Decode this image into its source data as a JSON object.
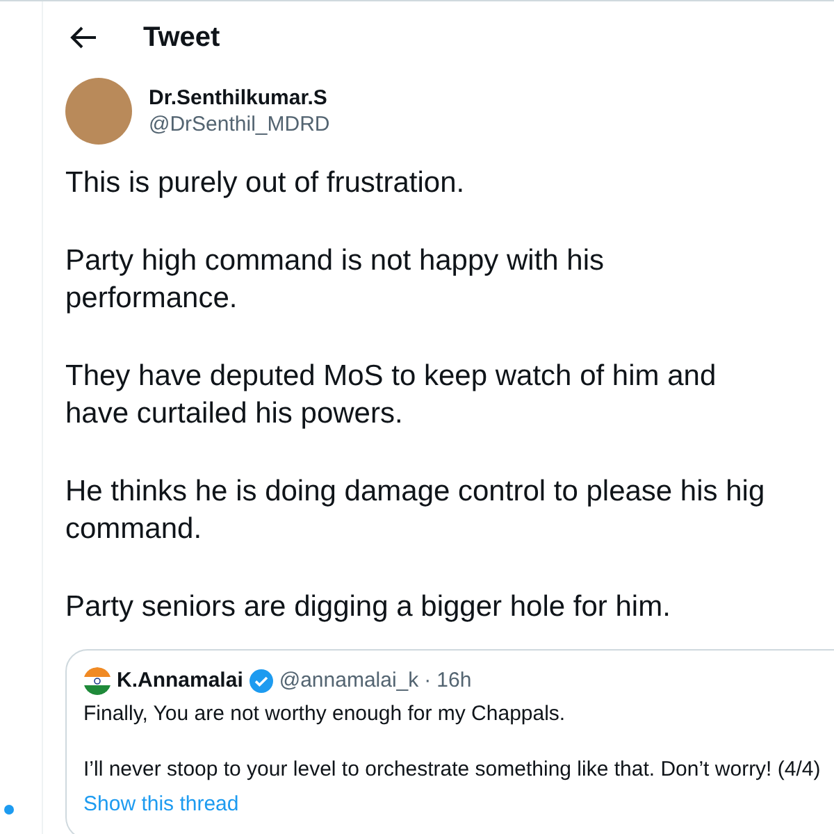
{
  "header": {
    "title": "Tweet"
  },
  "author": {
    "name": "Dr.Senthilkumar.S",
    "handle": "@DrSenthil_MDRD"
  },
  "paragraphs": [
    "This is purely out of frustration.",
    "Party high command is not happy with his\nperformance.",
    "They have deputed MoS to keep watch of him and\nhave curtailed his powers.",
    "He thinks he is doing damage control to please his hig\ncommand.",
    "Party seniors are digging a bigger hole for him."
  ],
  "quote": {
    "name": "K.Annamalai",
    "verified": true,
    "handle": "@annamalai_k",
    "separator": "·",
    "time": "16h",
    "paragraphs": [
      "Finally, You are not worthy enough for my Chappals.",
      "I’ll never stoop to your level to orchestrate something like that. Don’t worry! (4/4)"
    ],
    "link": "Show this thread"
  }
}
